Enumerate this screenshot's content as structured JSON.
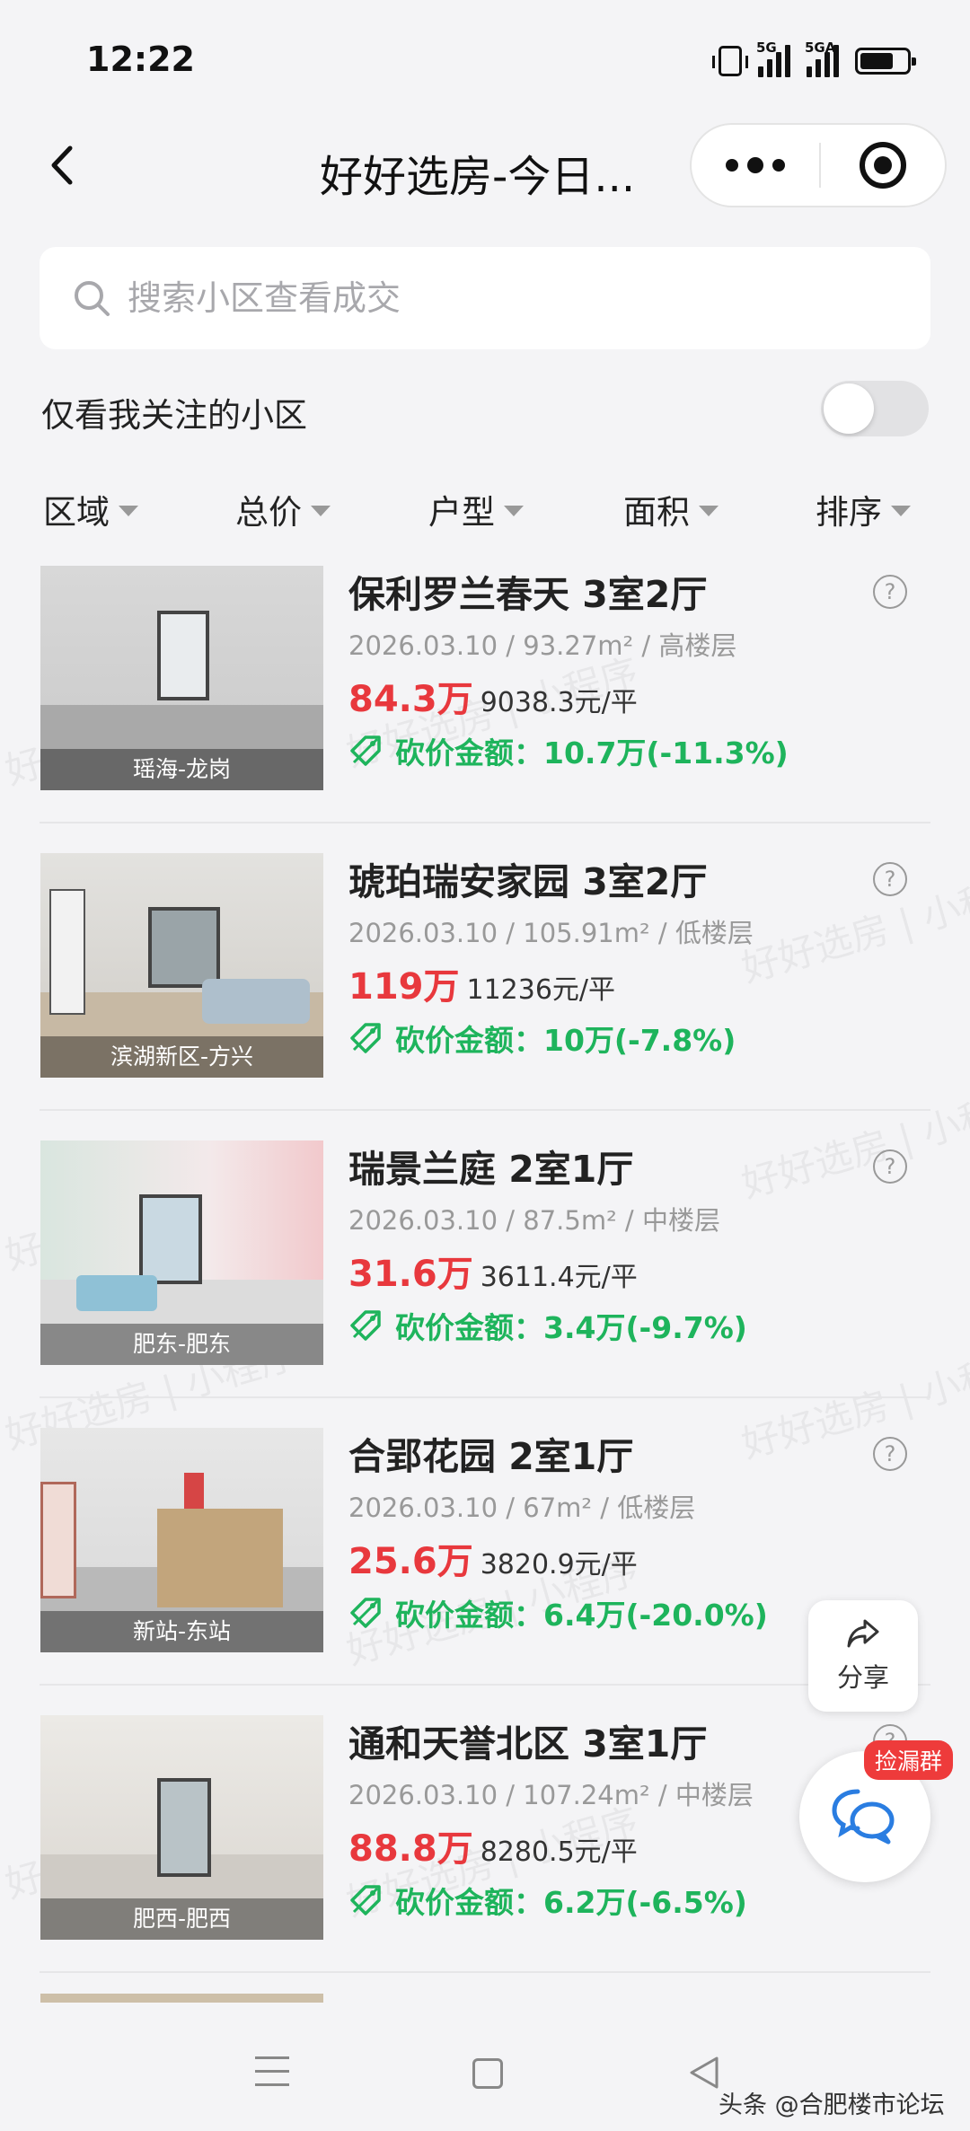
{
  "status_bar": {
    "time": "12:22",
    "signal1_label": "5G",
    "signal2_label": "5GA"
  },
  "nav": {
    "title": "好好选房-今日..."
  },
  "search": {
    "placeholder": "搜索小区查看成交"
  },
  "follow": {
    "label": "仅看我关注的小区",
    "enabled": false
  },
  "filters": [
    {
      "label": "区域"
    },
    {
      "label": "总价"
    },
    {
      "label": "户型"
    },
    {
      "label": "面积"
    },
    {
      "label": "排序"
    }
  ],
  "listings": [
    {
      "title": "保利罗兰春天 3室2厅",
      "date": "2026.03.10",
      "area": "93.27m²",
      "floor": "高楼层",
      "total_price": "84.3万",
      "unit_price": "9038.3元/平",
      "cut": "砍价金额：10.7万(-11.3%)",
      "district": "瑶海-龙岗"
    },
    {
      "title": "琥珀瑞安家园 3室2厅",
      "date": "2026.03.10",
      "area": "105.91m²",
      "floor": "低楼层",
      "total_price": "119万",
      "unit_price": "11236元/平",
      "cut": "砍价金额：10万(-7.8%)",
      "district": "滨湖新区-方兴"
    },
    {
      "title": "瑞景兰庭 2室1厅",
      "date": "2026.03.10",
      "area": "87.5m²",
      "floor": "中楼层",
      "total_price": "31.6万",
      "unit_price": "3611.4元/平",
      "cut": "砍价金额：3.4万(-9.7%)",
      "district": "肥东-肥东"
    },
    {
      "title": "合郢花园 2室1厅",
      "date": "2026.03.10",
      "area": "67m²",
      "floor": "低楼层",
      "total_price": "25.6万",
      "unit_price": "3820.9元/平",
      "cut": "砍价金额：6.4万(-20.0%)",
      "district": "新站-东站"
    },
    {
      "title": "通和天誉北区 3室1厅",
      "date": "2026.03.10",
      "area": "107.24m²",
      "floor": "中楼层",
      "total_price": "88.8万",
      "unit_price": "8280.5元/平",
      "cut": "砍价金额：6.2万(-6.5%)",
      "district": "肥西-肥西"
    }
  ],
  "meta_separator": " / ",
  "help_glyph": "?",
  "watermark": "好好选房 | 小程序",
  "share": {
    "label": "分享"
  },
  "chat": {
    "badge": "捡漏群"
  },
  "credit": "头条 @合肥楼市论坛",
  "colors": {
    "price_red": "#e8383d",
    "cut_green": "#1eb45c",
    "badge_red": "#ee3b3b"
  }
}
